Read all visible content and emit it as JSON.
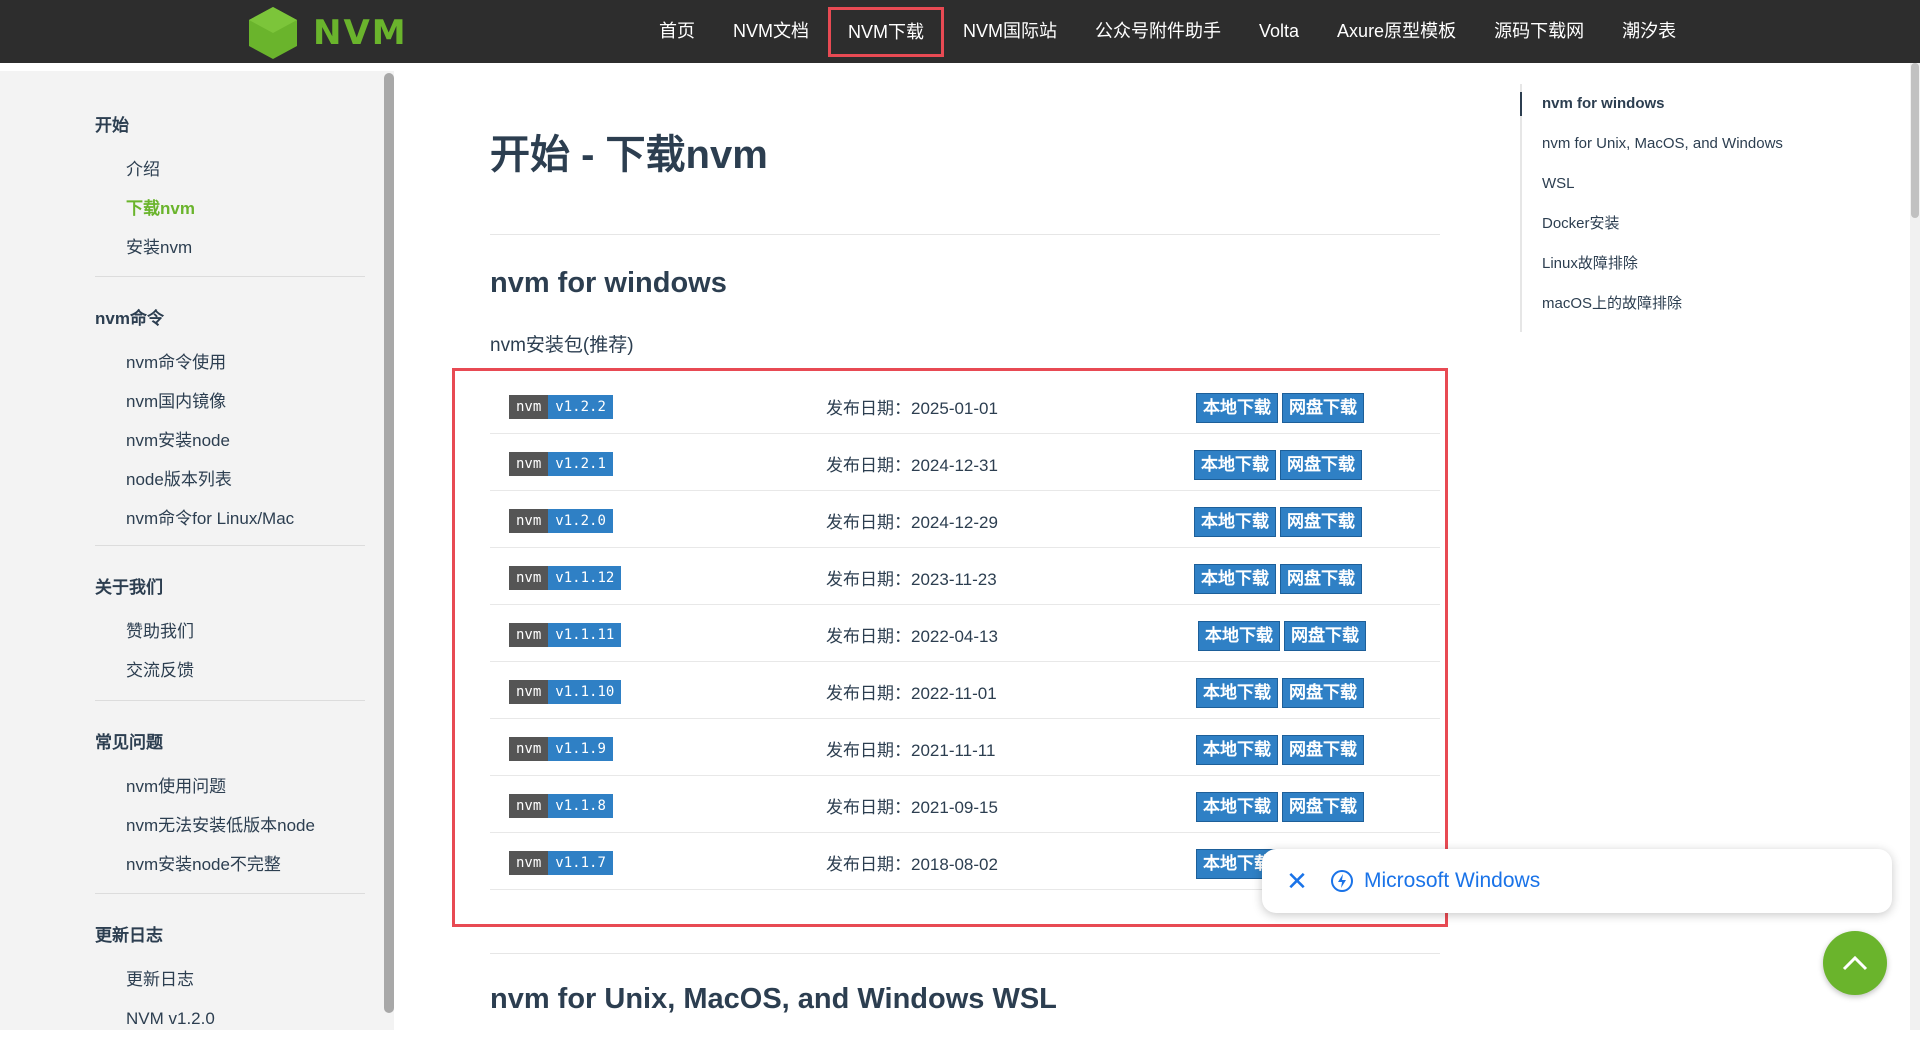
{
  "header": {
    "logo_text": "NVM",
    "brand_color": "#6ab42c",
    "nav": [
      {
        "label": "首页"
      },
      {
        "label": "NVM文档"
      },
      {
        "label": "NVM下载",
        "active": true
      },
      {
        "label": "NVM国际站"
      },
      {
        "label": "公众号附件助手"
      },
      {
        "label": "Volta"
      },
      {
        "label": "Axure原型模板"
      },
      {
        "label": "源码下载网"
      },
      {
        "label": "潮汐表"
      }
    ]
  },
  "sidebar": {
    "groups": [
      {
        "title": "开始",
        "items": [
          "介绍",
          "下载nvm",
          "安装nvm"
        ]
      },
      {
        "title": "nvm命令",
        "items": [
          "nvm命令使用",
          "nvm国内镜像",
          "nvm安装node",
          "node版本列表",
          "nvm命令for Linux/Mac"
        ]
      },
      {
        "title": "关于我们",
        "items": [
          "赞助我们",
          "交流反馈"
        ]
      },
      {
        "title": "常见问题",
        "items": [
          "nvm使用问题",
          "nvm无法安装低版本node",
          "nvm安装node不完整"
        ]
      },
      {
        "title": "更新日志",
        "items": [
          "更新日志",
          "NVM v1.2.0"
        ]
      }
    ],
    "active_item": "下载nvm"
  },
  "main": {
    "title": "开始 - 下载nvm",
    "section1_title": "nvm for windows",
    "section1_subtitle": "nvm安装包(推荐)",
    "badge_label": "nvm",
    "date_prefix": "发布日期：",
    "local_download": "本地下载",
    "cloud_download": "网盘下载",
    "releases": [
      {
        "version": "v1.2.2",
        "date": "2025-01-01"
      },
      {
        "version": "v1.2.1",
        "date": "2024-12-31"
      },
      {
        "version": "v1.2.0",
        "date": "2024-12-29"
      },
      {
        "version": "v1.1.12",
        "date": "2023-11-23"
      },
      {
        "version": "v1.1.11",
        "date": "2022-04-13"
      },
      {
        "version": "v1.1.10",
        "date": "2022-11-01"
      },
      {
        "version": "v1.1.9",
        "date": "2021-11-11"
      },
      {
        "version": "v1.1.8",
        "date": "2021-09-15"
      },
      {
        "version": "v1.1.7",
        "date": "2018-08-02"
      }
    ],
    "section2_title": "nvm for Unix, MacOS, and Windows WSL"
  },
  "toc": {
    "items": [
      "nvm for windows",
      "nvm for Unix, MacOS, and Windows",
      "WSL",
      "Docker安装",
      "Linux故障排除",
      "macOS上的故障排除"
    ]
  },
  "popup": {
    "text": "Microsoft Windows",
    "close_icon": "close-icon",
    "bolt_icon": "bolt-icon"
  }
}
